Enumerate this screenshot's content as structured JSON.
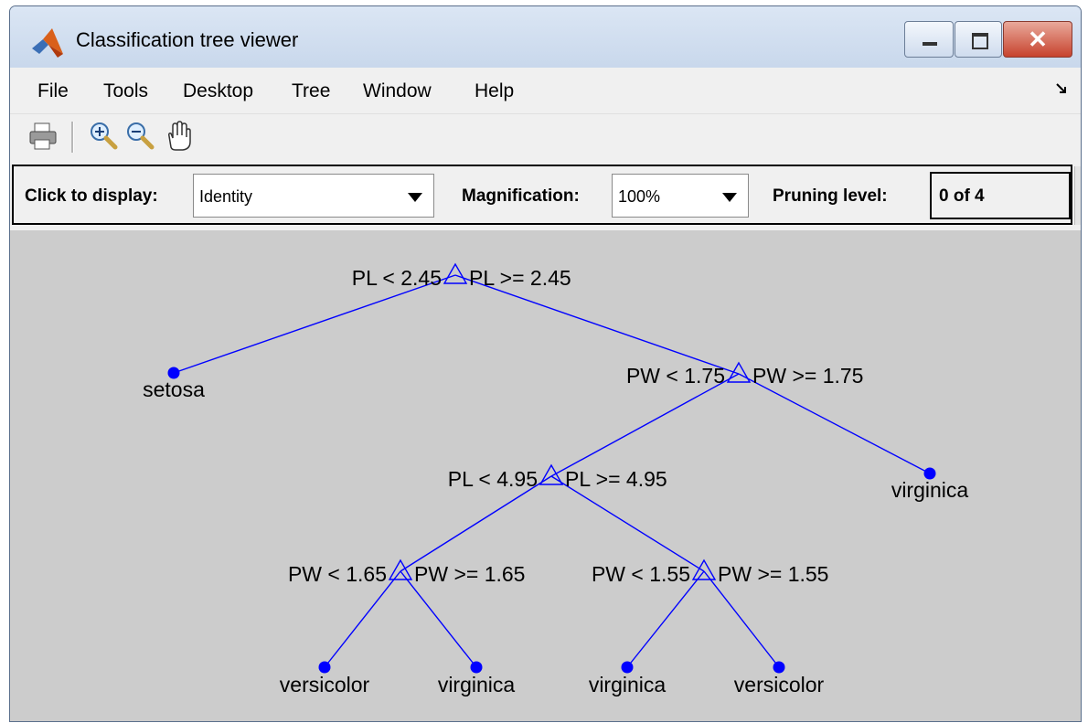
{
  "window": {
    "title": "Classification tree viewer",
    "close_glyph": "✕"
  },
  "menu": {
    "items": [
      "File",
      "Tools",
      "Desktop",
      "Tree",
      "Window",
      "Help"
    ]
  },
  "toolbar": {
    "icons": [
      "print-icon",
      "zoom-in-icon",
      "zoom-out-icon",
      "pan-hand-icon"
    ]
  },
  "controls": {
    "display_label": "Click to display:",
    "display_value": "Identity",
    "magnification_label": "Magnification:",
    "magnification_value": "100%",
    "pruning_label": "Pruning level:",
    "pruning_value": "0 of 4"
  },
  "tree": {
    "colors": {
      "line": "#0000ff",
      "leaf": "#0000ff"
    },
    "splits": [
      {
        "id": "n1",
        "left": "PL < 2.45",
        "right": "PL >= 2.45"
      },
      {
        "id": "n3",
        "left": "PW < 1.75",
        "right": "PW >= 1.75"
      },
      {
        "id": "n6",
        "left": "PL < 4.95",
        "right": "PL >= 4.95"
      },
      {
        "id": "n12",
        "left": "PW < 1.65",
        "right": "PW >= 1.65"
      },
      {
        "id": "n13",
        "left": "PW < 1.55",
        "right": "PW >= 1.55"
      }
    ],
    "leaves": [
      {
        "id": "n2",
        "label": "setosa"
      },
      {
        "id": "n7",
        "label": "virginica"
      },
      {
        "id": "n24",
        "label": "versicolor"
      },
      {
        "id": "n25",
        "label": "virginica"
      },
      {
        "id": "n26",
        "label": "virginica"
      },
      {
        "id": "n27",
        "label": "versicolor"
      }
    ]
  }
}
